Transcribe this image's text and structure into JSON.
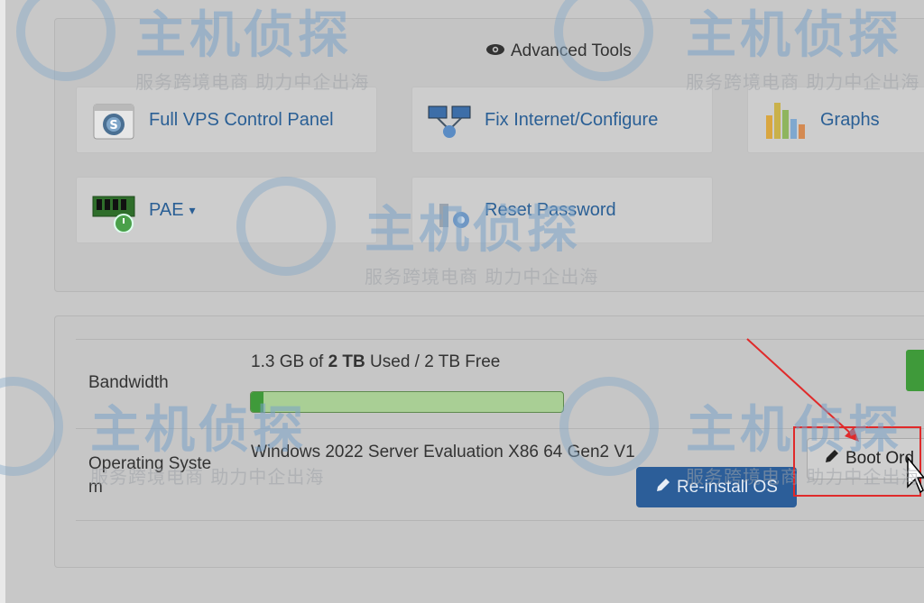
{
  "advanced_tools": {
    "title": "Advanced Tools",
    "icon": "eye-icon",
    "buttons": [
      {
        "label": "Full VPS Control Panel",
        "icon": "control-panel-icon"
      },
      {
        "label": "Fix Internet/Configure",
        "icon": "network-icon"
      },
      {
        "label": "Graphs",
        "icon": "graphs-icon"
      },
      {
        "label": "PAE",
        "icon": "memory-power-icon",
        "caret": "▾"
      },
      {
        "label": "Reset Password",
        "icon": "reset-password-icon"
      }
    ]
  },
  "info": {
    "bandwidth": {
      "label": "Bandwidth",
      "used": "1.3 GB",
      "of": "of",
      "total": "2 TB",
      "rest": "Used / 2 TB Free",
      "progress_fraction": 0.04
    },
    "os": {
      "label_line1": "Operating Syste",
      "label_line2": "m",
      "value": "Windows 2022 Server Evaluation X86 64 Gen2 V1",
      "reinstall_label": "Re-install OS",
      "boot_label": "Boot Ord"
    }
  },
  "watermark": {
    "brand": "主机侦探",
    "slogan": "服务跨境电商  助力中企出海"
  },
  "colors": {
    "link_blue": "#2a5f95",
    "primary_button": "#2c5e99",
    "progress_green": "#3f9a3a",
    "annotation_red": "#e02a2a"
  }
}
